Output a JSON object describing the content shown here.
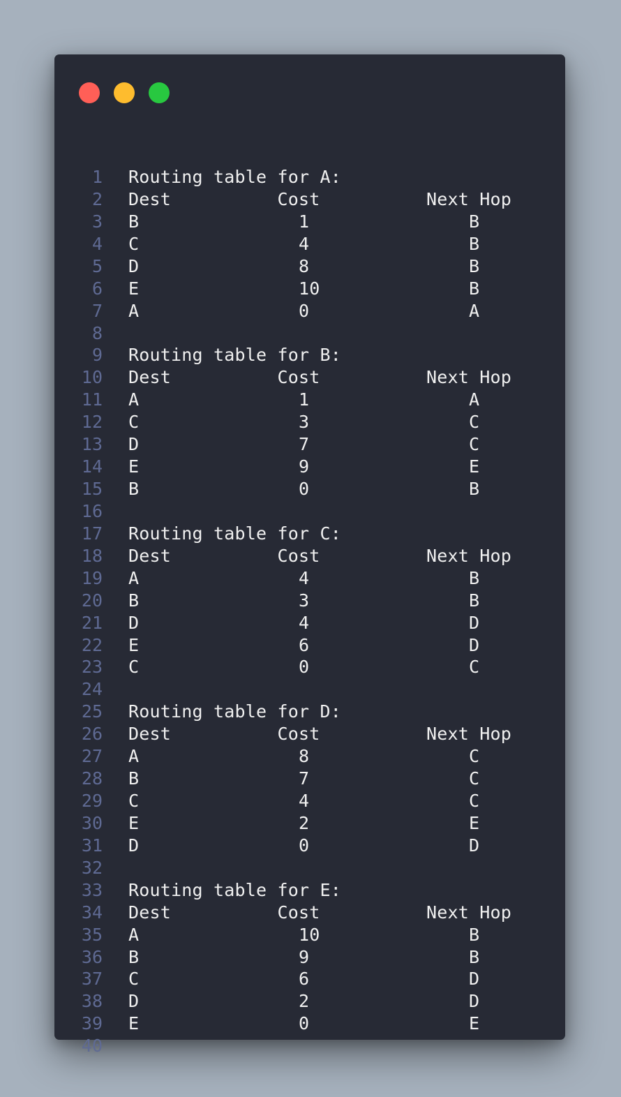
{
  "window": {
    "controls": [
      "close",
      "minimize",
      "maximize"
    ],
    "colors": {
      "background": "#272a35",
      "text": "#f0f0f0",
      "line_numbers": "#5f6a93",
      "close": "#ff5f57",
      "minimize": "#febc2e",
      "maximize": "#28c840"
    }
  },
  "lines": [
    {
      "n": "1",
      "text": "Routing table for A:"
    },
    {
      "n": "2",
      "text": "Dest          Cost          Next Hop"
    },
    {
      "n": "3",
      "text": "B               1               B"
    },
    {
      "n": "4",
      "text": "C               4               B"
    },
    {
      "n": "5",
      "text": "D               8               B"
    },
    {
      "n": "6",
      "text": "E               10              B"
    },
    {
      "n": "7",
      "text": "A               0               A"
    },
    {
      "n": "8",
      "text": ""
    },
    {
      "n": "9",
      "text": "Routing table for B:"
    },
    {
      "n": "10",
      "text": "Dest          Cost          Next Hop"
    },
    {
      "n": "11",
      "text": "A               1               A"
    },
    {
      "n": "12",
      "text": "C               3               C"
    },
    {
      "n": "13",
      "text": "D               7               C"
    },
    {
      "n": "14",
      "text": "E               9               E"
    },
    {
      "n": "15",
      "text": "B               0               B"
    },
    {
      "n": "16",
      "text": ""
    },
    {
      "n": "17",
      "text": "Routing table for C:"
    },
    {
      "n": "18",
      "text": "Dest          Cost          Next Hop"
    },
    {
      "n": "19",
      "text": "A               4               B"
    },
    {
      "n": "20",
      "text": "B               3               B"
    },
    {
      "n": "21",
      "text": "D               4               D"
    },
    {
      "n": "22",
      "text": "E               6               D"
    },
    {
      "n": "23",
      "text": "C               0               C"
    },
    {
      "n": "24",
      "text": ""
    },
    {
      "n": "25",
      "text": "Routing table for D:"
    },
    {
      "n": "26",
      "text": "Dest          Cost          Next Hop"
    },
    {
      "n": "27",
      "text": "A               8               C"
    },
    {
      "n": "28",
      "text": "B               7               C"
    },
    {
      "n": "29",
      "text": "C               4               C"
    },
    {
      "n": "30",
      "text": "E               2               E"
    },
    {
      "n": "31",
      "text": "D               0               D"
    },
    {
      "n": "32",
      "text": ""
    },
    {
      "n": "33",
      "text": "Routing table for E:"
    },
    {
      "n": "34",
      "text": "Dest          Cost          Next Hop"
    },
    {
      "n": "35",
      "text": "A               10              B"
    },
    {
      "n": "36",
      "text": "B               9               B"
    },
    {
      "n": "37",
      "text": "C               6               D"
    },
    {
      "n": "38",
      "text": "D               2               D"
    },
    {
      "n": "39",
      "text": "E               0               E"
    },
    {
      "n": "40",
      "text": ""
    }
  ]
}
